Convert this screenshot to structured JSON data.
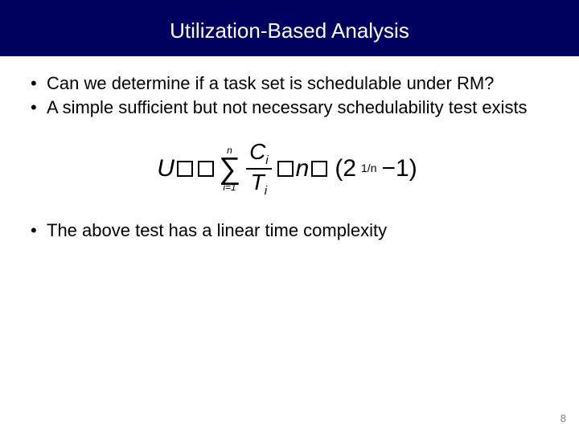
{
  "title": "Utilization-Based Analysis",
  "bullets": {
    "b1": "Can we determine if a task set is schedulable under RM?",
    "b2": "A simple sufficient but not necessary schedulability test exists",
    "b3": "The above test has a linear time complexity"
  },
  "formula": {
    "U": "U",
    "sum_upper": "n",
    "sum_lower": "i=1",
    "num": "C",
    "num_sub": "i",
    "den": "T",
    "den_sub": "i",
    "n": "n",
    "paren_open": "(2",
    "exp": "1/n",
    "minus": " −1)"
  },
  "page": "8"
}
